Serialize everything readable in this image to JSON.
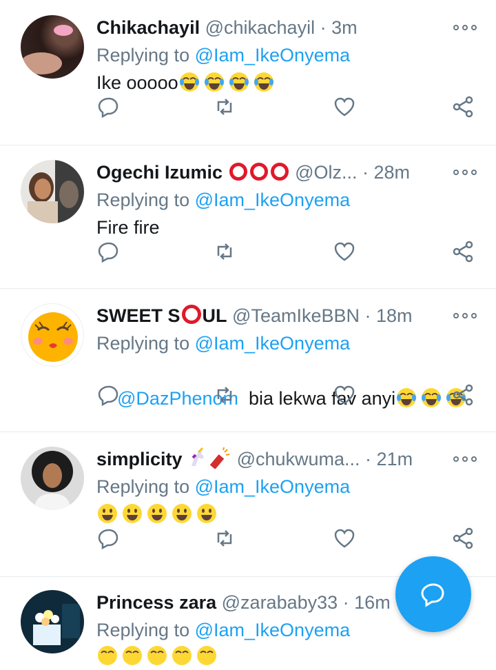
{
  "tweets": [
    {
      "name": "Chikachayil",
      "handle": "@chikachayil",
      "time": "3m",
      "replying_prefix": "Replying to ",
      "replying_to": "@Iam_IkeOnyema",
      "body_text": "Ike ooooo",
      "body_emoji": [
        "joy-emoji",
        "joy-emoji",
        "joy-emoji",
        "joy-emoji"
      ]
    },
    {
      "name": "Ogechi Izumic",
      "handle": "@Olz...",
      "time": "28m",
      "replying_prefix": "Replying to ",
      "replying_to": "@Iam_IkeOnyema",
      "body_text": "Fire fire"
    },
    {
      "name_part1": "SWEET S",
      "name_part2": "UL",
      "handle": "@TeamIkeBBN",
      "time": "18m",
      "replying_prefix": "Replying to ",
      "replying_to": "@Iam_IkeOnyema",
      "body_mention": "@DazPhenom",
      "body_text": "  bia lekwa fav anyi"
    },
    {
      "name": "simplicity",
      "handle": "@chukwuma...",
      "time": "21m",
      "replying_prefix": "Replying to ",
      "replying_to": "@Iam_IkeOnyema"
    },
    {
      "name": "Princess zara",
      "handle": "@zarababy33",
      "time": "16m",
      "replying_prefix": "Replying to ",
      "replying_to": "@Iam_IkeOnyema"
    }
  ],
  "separator": " · ",
  "colors": {
    "accent": "#1da1f2",
    "muted": "#657786",
    "text": "#14171a",
    "divider": "#e6ecf0",
    "ring": "#e0192b",
    "emoji": "#fdd835"
  },
  "fab_icon": "compose-reply-icon"
}
